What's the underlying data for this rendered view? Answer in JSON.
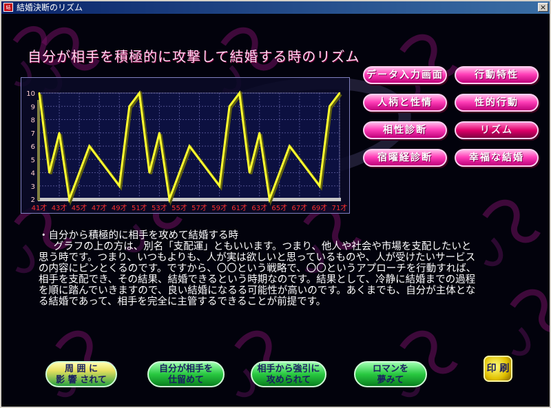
{
  "window": {
    "title": "結婚決断のリズム",
    "icon_label": "結婚",
    "close_label": "×"
  },
  "page": {
    "title": "自分が相手を積極的に攻撃して結婚する時のリズム"
  },
  "menu": [
    {
      "id": "data-entry",
      "label": "データ入力画面"
    },
    {
      "id": "behavior",
      "label": "行動特性"
    },
    {
      "id": "personality",
      "label": "人柄と性情"
    },
    {
      "id": "sexual-behavior",
      "label": "性的行動"
    },
    {
      "id": "compatibility",
      "label": "相性診断"
    },
    {
      "id": "rhythm",
      "label": "リズム",
      "active": true
    },
    {
      "id": "lunar-mansion",
      "label": "宿曜経診断"
    },
    {
      "id": "happy-marriage",
      "label": "幸福な結婚"
    }
  ],
  "description": {
    "heading": "・自分から積極的に相手を攻めて結婚する時",
    "body": "グラフの上の方は、別名「支配運」ともいいます。つまり、他人や社会や市場を支配したいと思う時です。つまり、いつもよりも、人が実は欲しいと思っているものや、人が受けたいサービスの内容にピンとくるのです。ですから、〇〇という戦略で、〇〇というアプローチを行動すれば、相手を支配でき、その結果、結婚できるという時期なのです。結果として、冷静に結婚までの過程を順に踏んでいきますので、良い結婚になるる可能性が高いのです。あくまでも、自分が主体となる結婚であって、相手を完全に主管するできることが前提です。"
  },
  "nav": [
    {
      "id": "influenced",
      "line1": "周 囲 に",
      "line2": "影 響 されて"
    },
    {
      "id": "self-catch",
      "line1": "自分が相手を",
      "line2": "仕留めて"
    },
    {
      "id": "forced",
      "line1": "相手から強引に",
      "line2": "攻められて"
    },
    {
      "id": "romance",
      "line1": "ロマンを",
      "line2": "夢みて"
    }
  ],
  "print": {
    "label": "印 刷"
  },
  "colors": {
    "line": "#ffff30",
    "xtick": "#ff3030",
    "ytick": "#ffd0d0",
    "accent": "#ff3fb8"
  },
  "chart_data": {
    "type": "line",
    "x": [
      41,
      42,
      43,
      44,
      45,
      46,
      47,
      48,
      49,
      50,
      51,
      52,
      53,
      54,
      55,
      56,
      57,
      58,
      59,
      60,
      61,
      62,
      63,
      64,
      65,
      66,
      67,
      68,
      69,
      70,
      71
    ],
    "values": [
      10,
      4,
      7,
      2,
      4,
      6,
      5,
      4,
      3,
      9,
      10,
      4,
      7,
      2,
      4,
      6,
      5,
      4,
      3,
      9,
      10,
      4,
      7,
      2,
      4,
      6,
      5,
      4,
      3,
      9,
      10
    ],
    "xtick_labels": [
      "41才",
      "43才",
      "45才",
      "47才",
      "49才",
      "51才",
      "53才",
      "55才",
      "57才",
      "59才",
      "61才",
      "63才",
      "65才",
      "67才",
      "69才",
      "71才"
    ],
    "ytick_labels": [
      "2",
      "3",
      "4",
      "5",
      "6",
      "7",
      "8",
      "9",
      "10"
    ],
    "ylim": [
      2,
      10
    ],
    "xlim": [
      41,
      71
    ],
    "grid": true
  }
}
